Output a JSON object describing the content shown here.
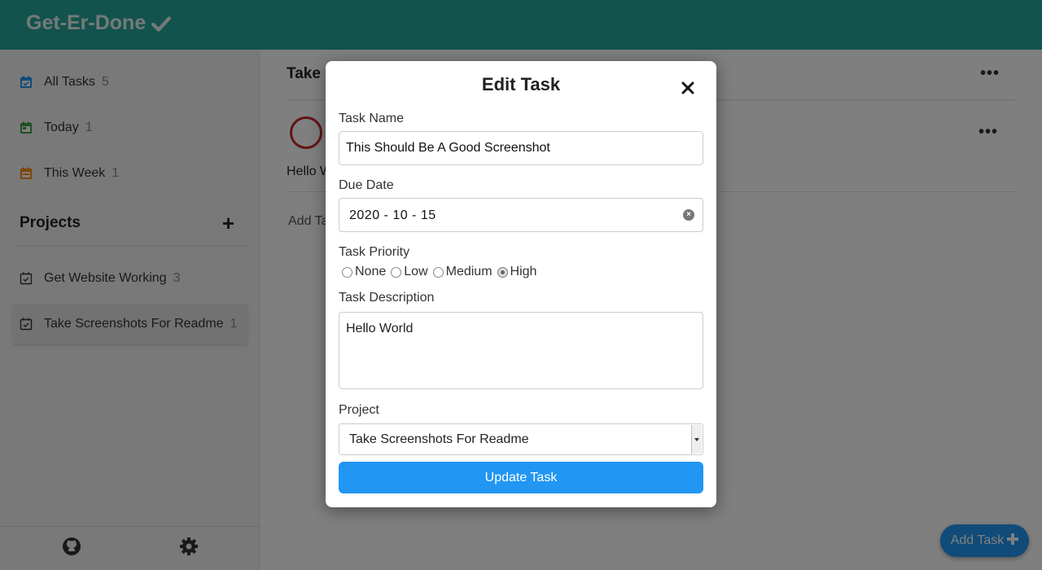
{
  "app": {
    "title": "Get-Er-Done",
    "title_icon": "check-icon",
    "accent": "#26a69a",
    "button_color": "#2196f3"
  },
  "sidebar": {
    "filters": [
      {
        "label": "All Tasks",
        "count": "5",
        "icon": "calendar-check-icon",
        "color": "#2196f3"
      },
      {
        "label": "Today",
        "count": "1",
        "icon": "calendar-day-icon",
        "color": "#43a047"
      },
      {
        "label": "This Week",
        "count": "1",
        "icon": "calendar-week-icon",
        "color": "#fb8c00"
      }
    ],
    "projects_heading": "Projects",
    "projects": [
      {
        "label": "Get Website Working",
        "count": "3",
        "active": false
      },
      {
        "label": "Take Screenshots For Readme",
        "count": "1",
        "active": true
      }
    ],
    "footer_icons": [
      "github-icon",
      "gear-icon"
    ]
  },
  "main": {
    "title": "Take Screenshots For Readme",
    "task_description": "Hello World",
    "add_task_link": "Add Task",
    "fab_label": "Add Task"
  },
  "modal": {
    "title": "Edit Task",
    "name_label": "Task Name",
    "name_value": "This Should Be A Good Screenshot",
    "due_label": "Due Date",
    "due_value": "2020 - 10 - 15",
    "priority_label": "Task Priority",
    "priority_options": [
      "None",
      "Low",
      "Medium",
      "High"
    ],
    "priority_selected": "High",
    "description_label": "Task Description",
    "description_value": "Hello World",
    "project_label": "Project",
    "project_value": "Take Screenshots For Readme",
    "submit_label": "Update Task"
  }
}
